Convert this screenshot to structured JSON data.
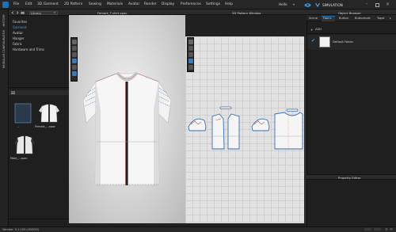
{
  "menu": {
    "items": [
      "File",
      "Edit",
      "3D Garment",
      "2D Pattern",
      "Sewing",
      "Materials",
      "Avatar",
      "Render",
      "Display",
      "Preferences",
      "Settings",
      "Help"
    ],
    "user": "Hello",
    "simulation_label": "SIMULATION"
  },
  "sidebar": {
    "history_label": "HISTORY",
    "modular_label": "MODULAR CONFIGURATOR"
  },
  "library": {
    "selected": "Library",
    "items": [
      "Favorites",
      "Garment",
      "Avatar",
      "Hanger",
      "Fabric",
      "Hardware and Trims"
    ],
    "files": [
      "..",
      "Female_...zpac",
      "Male_...zpac"
    ]
  },
  "window3d": {
    "title": "Female_T-shirt.zpac"
  },
  "window2d": {
    "title": "2D Pattern Window"
  },
  "object_browser": {
    "title": "Object Browser",
    "tabs": [
      "Scene",
      "Fabric",
      "Button",
      "Buttonhole",
      "Topst"
    ],
    "active_tab": "Fabric",
    "add_label": "ADD",
    "fabric_name": "Default Fabric"
  },
  "property_editor": {
    "title": "Property Editor"
  },
  "status": {
    "text": "Version: 5.1.103 (r30235)"
  },
  "colors": {
    "accent": "#1e6fb4",
    "pattern_outline": "#3b6fb4",
    "seam": "#c04b4b"
  }
}
